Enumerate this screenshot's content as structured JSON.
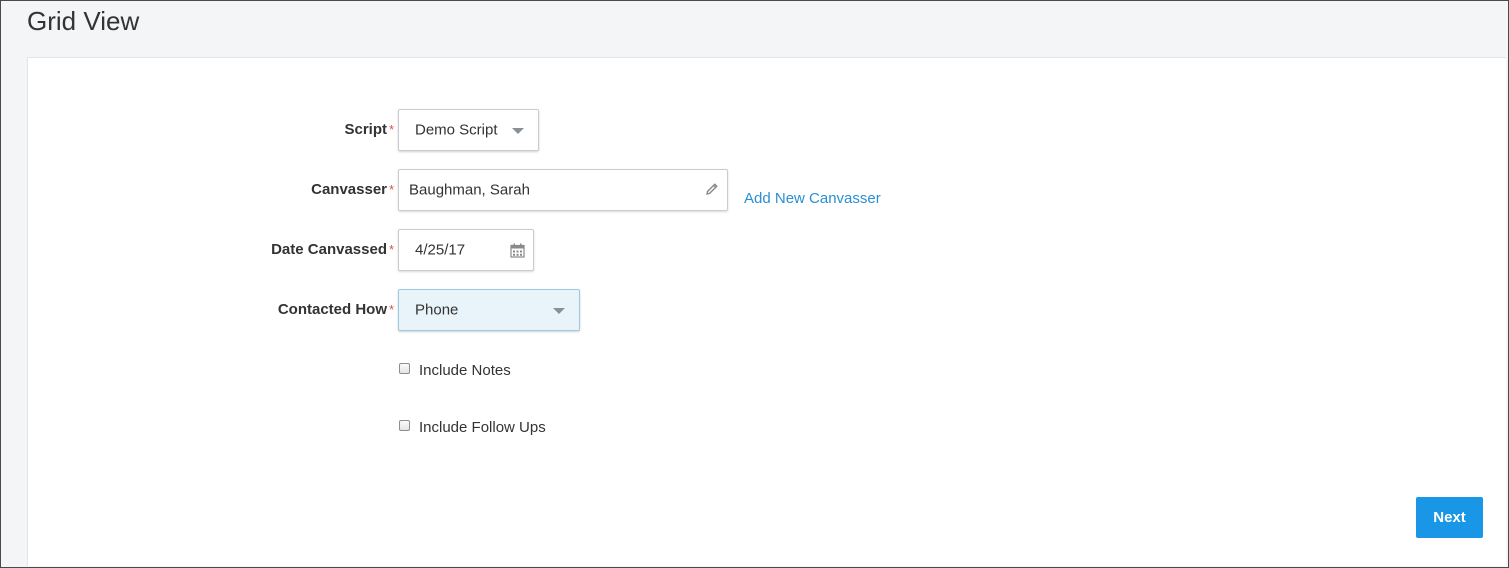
{
  "page": {
    "title": "Grid View"
  },
  "form": {
    "script": {
      "label": "Script",
      "required_mark": "*",
      "value": "Demo Script"
    },
    "canvasser": {
      "label": "Canvasser",
      "required_mark": "*",
      "value": "Baughman, Sarah",
      "add_link": "Add New Canvasser"
    },
    "date_canvassed": {
      "label": "Date Canvassed",
      "required_mark": "*",
      "value": "4/25/17"
    },
    "contacted_how": {
      "label": "Contacted How",
      "required_mark": "*",
      "value": "Phone"
    },
    "include_notes": {
      "label": "Include Notes",
      "checked": false
    },
    "include_follow_ups": {
      "label": "Include Follow Ups",
      "checked": false
    }
  },
  "actions": {
    "next_label": "Next"
  },
  "icons": {
    "script_dropdown": "chevron-down-icon",
    "canvasser_edit": "pencil-icon",
    "date_picker": "calendar-icon",
    "contacted_dropdown": "chevron-down-icon"
  },
  "colors": {
    "accent": "#1a96e6",
    "link": "#2a8fd4",
    "required": "#d9534f",
    "selected_field_bg": "#e8f4fa"
  }
}
